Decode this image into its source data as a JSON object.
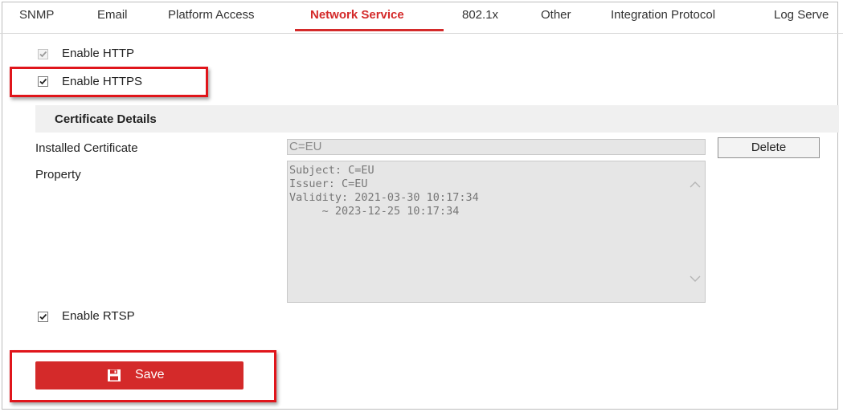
{
  "tabs": [
    "SNMP",
    "Email",
    "Platform Access",
    "Network Service",
    "802.1x",
    "Other",
    "Integration Protocol",
    "Log Serve"
  ],
  "active_tab": "Network Service",
  "options": {
    "http": {
      "label": "Enable HTTP",
      "checked": true,
      "disabled": true
    },
    "https": {
      "label": "Enable HTTPS",
      "checked": true,
      "disabled": false
    },
    "rtsp": {
      "label": "Enable RTSP",
      "checked": true,
      "disabled": false
    }
  },
  "certificate": {
    "section_title": "Certificate Details",
    "installed_label": "Installed Certificate",
    "installed_value": "C=EU",
    "delete_label": "Delete",
    "property_label": "Property",
    "property_lines": [
      "Subject: C=EU",
      "Issuer: C=EU",
      "Validity: 2021-03-30 10:17:34",
      "     ~ 2023-12-25 10:17:34"
    ]
  },
  "save": {
    "label": "Save",
    "icon": "floppy-disk-icon"
  },
  "colors": {
    "accent": "#d42a2a",
    "highlight": "#e0151b",
    "section_bg": "#f0f0f0",
    "readonly_bg": "#e6e6e6"
  }
}
